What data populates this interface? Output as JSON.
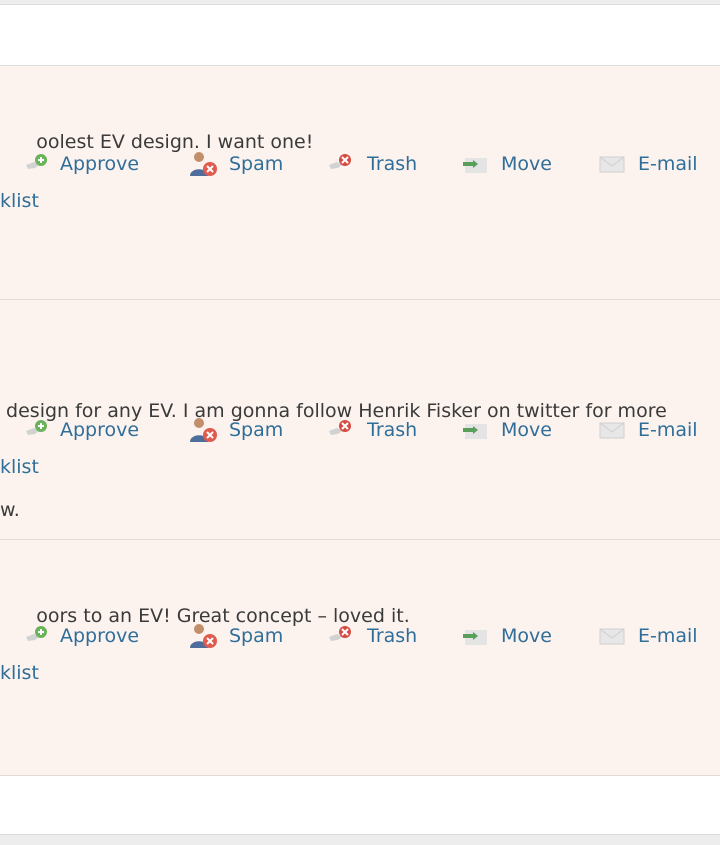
{
  "actions": {
    "approve": "Approve",
    "spam": "Spam",
    "trash": "Trash",
    "move": "Move",
    "email": "E-mail",
    "blacklist": "klist"
  },
  "icons": {
    "approve": "approve-icon",
    "spam": "spam-user-icon",
    "trash": "trash-icon",
    "move": "move-icon",
    "email": "email-icon"
  },
  "colors": {
    "link": "#2f6e99",
    "row_background": "#fcf3ef",
    "approve_green": "#6bb35a",
    "spam_red": "#e05a4e"
  },
  "comments": [
    {
      "lines": [
        "oolest EV design. I want one!"
      ]
    },
    {
      "lines": [
        " design for any EV. I am gonna follow Henrik Fisker on twitter for more",
        "w."
      ]
    },
    {
      "lines": [
        "oors to an EV! Great concept – loved it."
      ]
    }
  ]
}
